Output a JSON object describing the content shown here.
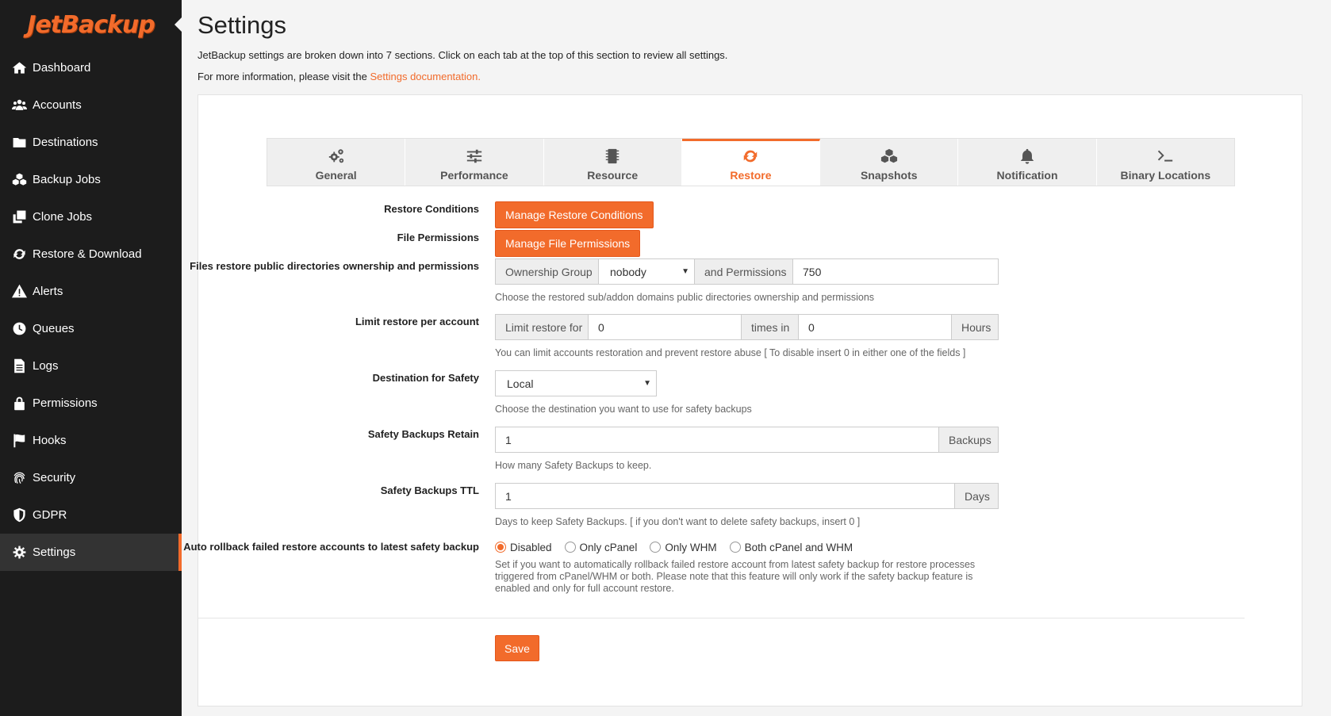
{
  "brand": {
    "name": "JetBackup",
    "accent": "#f26b2b",
    "sidebar_bg": "#1c1c1c"
  },
  "sidebar": {
    "items": [
      {
        "label": "Dashboard",
        "icon": "home-icon"
      },
      {
        "label": "Accounts",
        "icon": "users-icon"
      },
      {
        "label": "Destinations",
        "icon": "folder-icon"
      },
      {
        "label": "Backup Jobs",
        "icon": "cubes-icon"
      },
      {
        "label": "Clone Jobs",
        "icon": "clone-icon"
      },
      {
        "label": "Restore & Download",
        "icon": "refresh-icon"
      },
      {
        "label": "Alerts",
        "icon": "warning-icon"
      },
      {
        "label": "Queues",
        "icon": "clock-icon"
      },
      {
        "label": "Logs",
        "icon": "file-icon"
      },
      {
        "label": "Permissions",
        "icon": "lock-icon"
      },
      {
        "label": "Hooks",
        "icon": "flag-icon"
      },
      {
        "label": "Security",
        "icon": "fingerprint-icon"
      },
      {
        "label": "GDPR",
        "icon": "shield-icon"
      },
      {
        "label": "Settings",
        "icon": "gears-icon",
        "active": true
      }
    ]
  },
  "header": {
    "title": "Settings",
    "intro": "JetBackup settings are broken down into 7 sections. Click on each tab at the top of this section to review all settings.",
    "more_prefix": "For more information, please visit the ",
    "more_link": "Settings documentation."
  },
  "tabs": [
    {
      "label": "General",
      "icon": "gears-icon"
    },
    {
      "label": "Performance",
      "icon": "sliders-icon"
    },
    {
      "label": "Resource",
      "icon": "microchip-icon"
    },
    {
      "label": "Restore",
      "icon": "refresh-icon",
      "active": true
    },
    {
      "label": "Snapshots",
      "icon": "cubes-icon"
    },
    {
      "label": "Notification",
      "icon": "bell-icon"
    },
    {
      "label": "Binary Locations",
      "icon": "terminal-icon"
    }
  ],
  "form": {
    "restore_conditions": {
      "label": "Restore Conditions",
      "button": "Manage Restore Conditions"
    },
    "file_permissions": {
      "label": "File Permissions",
      "button": "Manage File Permissions"
    },
    "ownership": {
      "label": "Files restore public directories ownership and permissions",
      "group_addon": "Ownership Group",
      "group_value": "nobody",
      "perm_addon": "and Permissions",
      "perm_value": "750",
      "help": "Choose the restored sub/addon domains public directories ownership and permissions"
    },
    "limit": {
      "label": "Limit restore per account",
      "addon1": "Limit restore for",
      "value1": "0",
      "addon2": "times in",
      "value2": "0",
      "addon3": "Hours",
      "help": "You can limit accounts restoration and prevent restore abuse [ To disable insert 0 in either one of the fields ]"
    },
    "destination": {
      "label": "Destination for Safety",
      "value": "Local",
      "help": "Choose the destination you want to use for safety backups"
    },
    "retain": {
      "label": "Safety Backups Retain",
      "value": "1",
      "addon": "Backups",
      "help": "How many Safety Backups to keep."
    },
    "ttl": {
      "label": "Safety Backups TTL",
      "value": "1",
      "addon": "Days",
      "help": "Days to keep Safety Backups. [ if you don't want to delete safety backups, insert 0 ]"
    },
    "rollback": {
      "label": "Auto rollback failed restore accounts to latest safety backup",
      "options": [
        "Disabled",
        "Only cPanel",
        "Only WHM",
        "Both cPanel and WHM"
      ],
      "selected": "Disabled",
      "help": "Set if you want to automatically rollback failed restore account from latest safety backup for restore processes triggered from cPanel/WHM or both. Please note that this feature will only work if the safety backup feature is enabled and only for full account restore."
    },
    "save": "Save"
  }
}
